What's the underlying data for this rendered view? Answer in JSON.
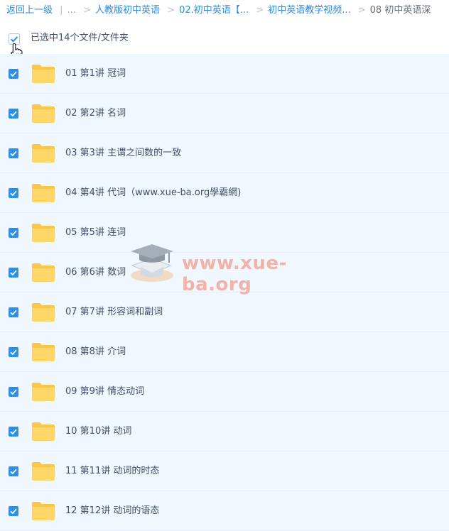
{
  "breadcrumb": {
    "back": "返回上一级",
    "divider": "|",
    "ellipsis": "...",
    "sep": ">",
    "items": [
      "人教版初中英语",
      "02.初中英语【...",
      "初中英语教学视频..."
    ],
    "current": "08 初中英语深"
  },
  "selection": {
    "label": "已选中14个文件/文件夹"
  },
  "files": [
    "01 第1讲 冠词",
    "02 第2讲 名词",
    "03 第3讲 主谓之间数的一致",
    "04 第4讲 代词（www.xue-ba.org學霸網)",
    "05 第5讲 连词",
    "06 第6讲 数词",
    "07 第7讲 形容词和副词",
    "08 第8讲 介词",
    "09 第9讲 情态动词",
    "10 第10讲 动词",
    "11 第11讲 动词的时态",
    "12 第12讲 动词的语态"
  ],
  "watermark": "www.xue-ba.org",
  "colors": {
    "accent": "#2e8fea",
    "link": "#2b8be6",
    "row_bg": "#f1f7fe",
    "folder": "#ffd35c"
  },
  "icons": {
    "checkbox": "checkmark-icon",
    "folder": "folder-icon",
    "cursor": "hand-pointer-icon"
  }
}
